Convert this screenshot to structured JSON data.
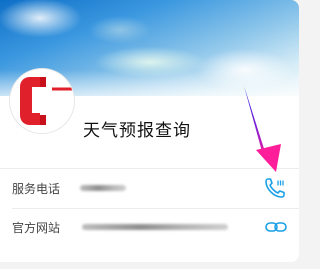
{
  "app": {
    "title": "天气预报查询"
  },
  "rows": [
    {
      "label": "服务电话",
      "action_icon": "phone-icon"
    },
    {
      "label": "官方网站",
      "action_icon": "link-icon"
    }
  ],
  "colors": {
    "accent": "#1aa0e6",
    "logo_red": "#e0202a",
    "annotation_arrow": "#ff1e9a"
  }
}
